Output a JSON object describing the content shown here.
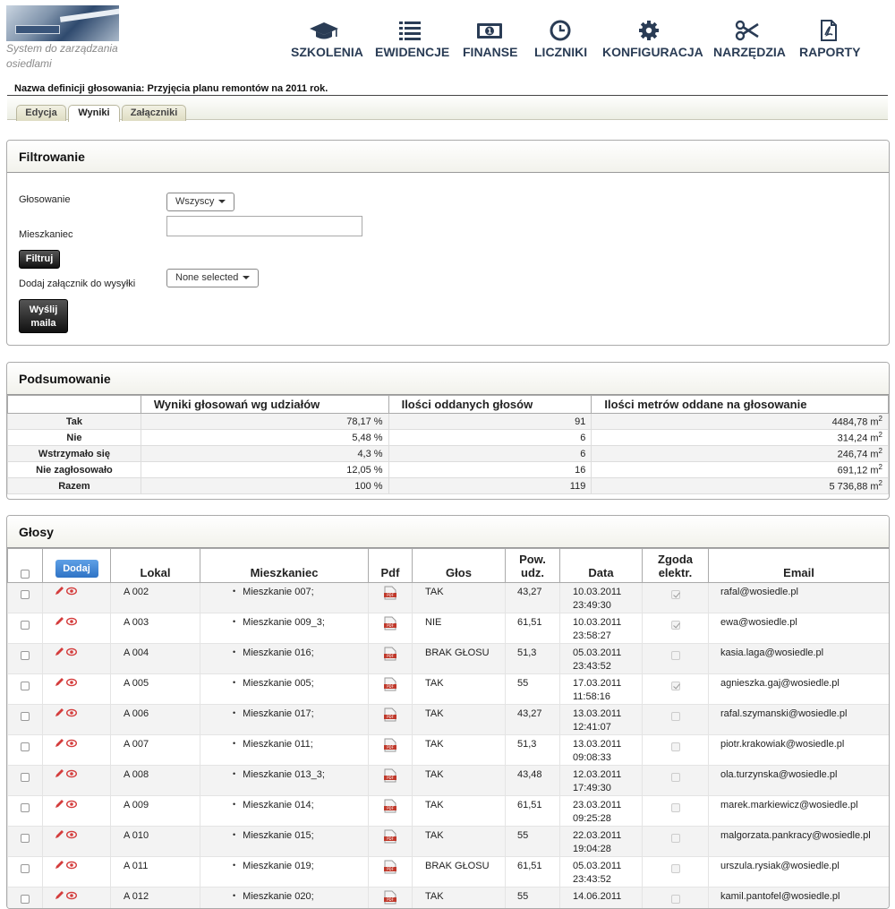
{
  "app": {
    "tagline": "System do zarządzania osiedlami"
  },
  "nav": [
    {
      "label": "SZKOLENIA",
      "icon": "graduation-cap-icon"
    },
    {
      "label": "EWIDENCJE",
      "icon": "list-icon"
    },
    {
      "label": "FINANSE",
      "icon": "money-icon"
    },
    {
      "label": "LICZNIKI",
      "icon": "clock-icon"
    },
    {
      "label": "KONFIGURACJA",
      "icon": "gear-icon"
    },
    {
      "label": "NARZĘDZIA",
      "icon": "scissors-icon"
    },
    {
      "label": "RAPORTY",
      "icon": "pdf-file-icon"
    }
  ],
  "voting": {
    "title": "Nazwa definicji głosowania: Przyjęcia planu remontów na 2011 rok."
  },
  "tabs": [
    {
      "label": "Edycja",
      "active": false
    },
    {
      "label": "Wyniki",
      "active": true
    },
    {
      "label": "Załączniki",
      "active": false
    }
  ],
  "filter": {
    "heading": "Filtrowanie",
    "voting_label": "Głosowanie",
    "voting_value": "Wszyscy",
    "resident_label": "Mieszkaniec",
    "resident_value": "",
    "filter_button": "Filtruj",
    "attachment_label": "Dodaj załącznik do wysyłki",
    "attachment_value": "None selected",
    "send_button_line1": "Wyślij",
    "send_button_line2": "maila"
  },
  "summary": {
    "heading": "Podsumowanie",
    "columns": [
      "",
      "Wyniki głosowań wg udziałów",
      "Ilości oddanych głosów",
      "Ilości metrów oddane na głosowanie"
    ],
    "unit_sup": "2",
    "rows": [
      {
        "label": "Tak",
        "share": "78,17 %",
        "votes": "91",
        "meters": "4484,78 m"
      },
      {
        "label": "Nie",
        "share": "5,48 %",
        "votes": "6",
        "meters": "314,24 m"
      },
      {
        "label": "Wstrzymało się",
        "share": "4,3 %",
        "votes": "6",
        "meters": "246,74 m"
      },
      {
        "label": "Nie zagłosowało",
        "share": "12,05 %",
        "votes": "16",
        "meters": "691,12 m"
      },
      {
        "label": "Razem",
        "share": "100 %",
        "votes": "119",
        "meters": "5 736,88 m"
      }
    ]
  },
  "votes": {
    "heading": "Głosy",
    "add_button": "Dodaj",
    "columns": {
      "lokal": "Lokal",
      "resident": "Mieszkaniec",
      "pdf": "Pdf",
      "vote": "Głos",
      "area": "Pow. udz.",
      "date": "Data",
      "consent": "Zgoda elektr.",
      "email": "Email"
    },
    "rows": [
      {
        "lokal": "A 002",
        "resident": "Mieszkanie 007;",
        "vote": "TAK",
        "area": "43,27",
        "date": "10.03.2011",
        "time": "23:49:30",
        "consent": true,
        "email": "rafal@wosiedle.pl"
      },
      {
        "lokal": "A 003",
        "resident": "Mieszkanie 009_3;",
        "vote": "NIE",
        "area": "61,51",
        "date": "10.03.2011",
        "time": "23:58:27",
        "consent": true,
        "email": "ewa@wosiedle.pl"
      },
      {
        "lokal": "A 004",
        "resident": "Mieszkanie 016;",
        "vote": "BRAK GŁOSU",
        "area": "51,3",
        "date": "05.03.2011",
        "time": "23:43:52",
        "consent": false,
        "email": "kasia.laga@wosiedle.pl"
      },
      {
        "lokal": "A 005",
        "resident": "Mieszkanie 005;",
        "vote": "TAK",
        "area": "55",
        "date": "17.03.2011",
        "time": "11:58:16",
        "consent": true,
        "email": "agnieszka.gaj@wosiedle.pl"
      },
      {
        "lokal": "A 006",
        "resident": "Mieszkanie 017;",
        "vote": "TAK",
        "area": "43,27",
        "date": "13.03.2011",
        "time": "12:41:07",
        "consent": false,
        "email": "rafal.szymanski@wosiedle.pl"
      },
      {
        "lokal": "A 007",
        "resident": "Mieszkanie 011;",
        "vote": "TAK",
        "area": "51,3",
        "date": "13.03.2011",
        "time": "09:08:33",
        "consent": false,
        "email": "piotr.krakowiak@wosiedle.pl"
      },
      {
        "lokal": "A 008",
        "resident": "Mieszkanie 013_3;",
        "vote": "TAK",
        "area": "43,48",
        "date": "12.03.2011",
        "time": "17:49:30",
        "consent": false,
        "email": "ola.turzynska@wosiedle.pl"
      },
      {
        "lokal": "A 009",
        "resident": "Mieszkanie 014;",
        "vote": "TAK",
        "area": "61,51",
        "date": "23.03.2011",
        "time": "09:25:28",
        "consent": false,
        "email": "marek.markiewicz@wosiedle.pl"
      },
      {
        "lokal": "A 010",
        "resident": "Mieszkanie 015;",
        "vote": "TAK",
        "area": "55",
        "date": "22.03.2011",
        "time": "19:04:28",
        "consent": false,
        "email": "malgorzata.pankracy@wosiedle.pl"
      },
      {
        "lokal": "A 011",
        "resident": "Mieszkanie 019;",
        "vote": "BRAK GŁOSU",
        "area": "61,51",
        "date": "05.03.2011",
        "time": "23:43:52",
        "consent": false,
        "email": "urszula.rysiak@wosiedle.pl"
      },
      {
        "lokal": "A 012",
        "resident": "Mieszkanie 020;",
        "vote": "TAK",
        "area": "55",
        "date": "14.06.2011",
        "time": "",
        "consent": false,
        "email": "kamil.pantofel@wosiedle.pl"
      }
    ]
  },
  "colors": {
    "nav_text": "#2a3c55",
    "edit_icon": "#d43c3c",
    "add_button": "#3a80d2"
  }
}
